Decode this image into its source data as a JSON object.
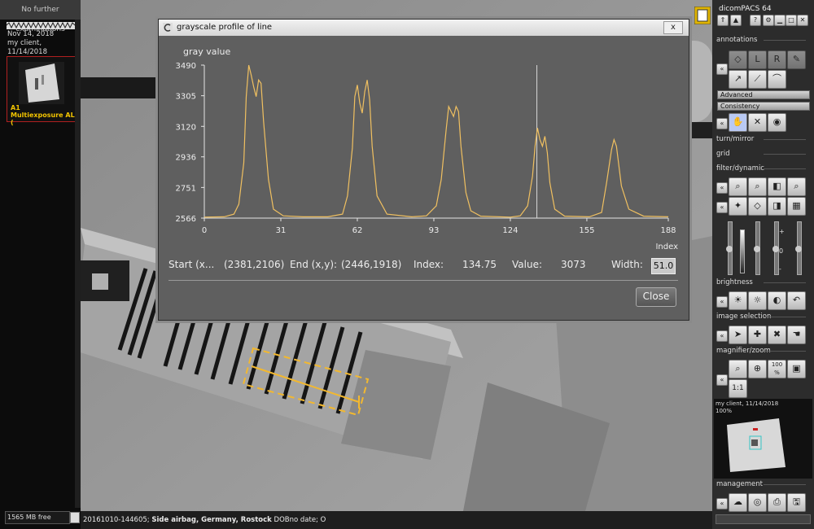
{
  "left_panel": {
    "header": "No further examinations",
    "study_date": "Nov 14, 2018",
    "client": "my client,",
    "client_date": "11/14/2018",
    "thumb_id": "A1",
    "thumb_title": "Multiexposure AL (",
    "free_space": "1565 MB free"
  },
  "status_bar": {
    "id": "20161010-144605;",
    "desc": "Side airbag, Germany, Rostock",
    "rest": "DOBno date; O"
  },
  "dialog": {
    "title": "grayscale profile of line",
    "close_x": "x",
    "close_button": "Close",
    "info": {
      "start_label": "Start (x...",
      "start_value": "(2381,2106)",
      "end_label": "End (x,y):",
      "end_value": "(2446,1918)",
      "index_label": "Index:",
      "index_value": "134.75",
      "value_label": "Value:",
      "value_value": "3073",
      "width_label": "Width:",
      "width_value": "51.0"
    }
  },
  "chart_data": {
    "type": "line",
    "title": "",
    "ylabel": "gray value",
    "xlabel": "Index",
    "xlim": [
      0,
      188
    ],
    "ylim": [
      2566,
      3490
    ],
    "xticks": [
      0,
      31,
      62,
      93,
      124,
      155,
      188
    ],
    "yticks": [
      2566,
      2751,
      2936,
      3120,
      3305,
      3490
    ],
    "cursor_index": 134.75,
    "line_color": "#f0c060",
    "peaks": [
      {
        "x": 18,
        "y": 3490
      },
      {
        "x": 22,
        "y": 3400
      },
      {
        "x": 62,
        "y": 3370
      },
      {
        "x": 66,
        "y": 3400
      },
      {
        "x": 99,
        "y": 3240
      },
      {
        "x": 102,
        "y": 3240
      },
      {
        "x": 135,
        "y": 3110
      },
      {
        "x": 138,
        "y": 3060
      },
      {
        "x": 166,
        "y": 3040
      }
    ],
    "series": [
      {
        "x": [
          0,
          8,
          12,
          14,
          16,
          17,
          18,
          19,
          20,
          21,
          22,
          23,
          24,
          26,
          28,
          32,
          40,
          50,
          56,
          58,
          60,
          61,
          62,
          63,
          64,
          65,
          66,
          67,
          68,
          70,
          74,
          84,
          90,
          94,
          96,
          98,
          99,
          100,
          101,
          102,
          103,
          104,
          106,
          108,
          112,
          124,
          128,
          131,
          133,
          134,
          135,
          136,
          137,
          138,
          139,
          140,
          142,
          146,
          156,
          161,
          163,
          165,
          166,
          167,
          169,
          172,
          178,
          188
        ],
        "y": [
          2572,
          2574,
          2590,
          2650,
          2900,
          3300,
          3490,
          3430,
          3360,
          3300,
          3400,
          3380,
          3150,
          2800,
          2620,
          2580,
          2574,
          2574,
          2590,
          2700,
          2990,
          3300,
          3370,
          3260,
          3200,
          3330,
          3400,
          3280,
          3000,
          2700,
          2590,
          2574,
          2580,
          2640,
          2800,
          3100,
          3240,
          3210,
          3180,
          3240,
          3210,
          3000,
          2720,
          2610,
          2578,
          2572,
          2580,
          2640,
          2820,
          3000,
          3110,
          3040,
          3000,
          3060,
          2960,
          2780,
          2620,
          2578,
          2574,
          2600,
          2780,
          2980,
          3040,
          3000,
          2760,
          2620,
          2578,
          2574
        ]
      }
    ]
  },
  "right_panel": {
    "app_title": "dicomPACS 64",
    "sections": {
      "annotations": "annotations",
      "advanced": "Advanced",
      "consistency": "Consistency",
      "turn_mirror": "turn/mirror",
      "grid": "grid",
      "filter": "filter/dynamic",
      "brightness": "brightness",
      "image_selection": "image selection",
      "magnifier": "magnifier/zoom",
      "management": "management"
    },
    "zoom_100": "100 %",
    "zoom_11": "1:1",
    "preview_caption": "my client, 11/14/2018",
    "preview_zoom": "100%",
    "slider_plus": "+",
    "slider_zero": "0",
    "slider_minus": "-"
  }
}
